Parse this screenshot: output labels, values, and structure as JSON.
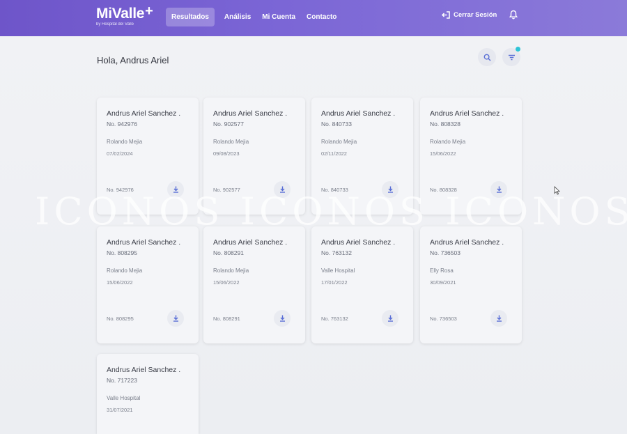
{
  "brand": {
    "name": "MiValle",
    "plus": "+",
    "subtitle": "by Hospital del Valle"
  },
  "nav": [
    {
      "label": "Resultados",
      "active": true
    },
    {
      "label": "Análisis",
      "active": false
    },
    {
      "label": "Mi Cuenta",
      "active": false
    },
    {
      "label": "Contacto",
      "active": false
    }
  ],
  "header": {
    "logout_label": "Cerrar Sesión",
    "logout_icon": "logout-icon",
    "notifications_icon": "bell-icon"
  },
  "page": {
    "greeting": "Hola, Andrus Ariel",
    "search_icon": "search-icon",
    "filter_icon": "filter-icon"
  },
  "results": [
    {
      "name": "Andrus Ariel Sanchez .",
      "number": "No. 942976",
      "doctor": "Rolando Mejia",
      "date": "07/02/2024",
      "footer": "No. 942976"
    },
    {
      "name": "Andrus Ariel Sanchez .",
      "number": "No. 902577",
      "doctor": "Rolando Mejia",
      "date": "09/08/2023",
      "footer": "No. 902577"
    },
    {
      "name": "Andrus Ariel Sanchez .",
      "number": "No. 840733",
      "doctor": "Rolando Mejia",
      "date": "02/11/2022",
      "footer": "No. 840733"
    },
    {
      "name": "Andrus Ariel Sanchez .",
      "number": "No. 808328",
      "doctor": "Rolando Mejia",
      "date": "15/06/2022",
      "footer": "No. 808328"
    },
    {
      "name": "Andrus Ariel Sanchez .",
      "number": "No. 808295",
      "doctor": "Rolando Mejia",
      "date": "15/06/2022",
      "footer": "No. 808295"
    },
    {
      "name": "Andrus Ariel Sanchez .",
      "number": "No. 808291",
      "doctor": "Rolando Mejia",
      "date": "15/06/2022",
      "footer": "No. 808291"
    },
    {
      "name": "Andrus Ariel Sanchez .",
      "number": "No. 763132",
      "doctor": "Valle Hospital",
      "date": "17/01/2022",
      "footer": "No. 763132"
    },
    {
      "name": "Andrus Ariel Sanchez .",
      "number": "No. 736503",
      "doctor": "Elly Rosa",
      "date": "30/09/2021",
      "footer": "No. 736503"
    },
    {
      "name": "Andrus Ariel Sanchez .",
      "number": "No. 717223",
      "doctor": "Valle Hospital",
      "date": "31/07/2021",
      "footer": ""
    }
  ],
  "watermark": "ICONOS ICONOS ICONOS",
  "colors": {
    "brand_purple": "#6e55c9",
    "accent_teal": "#2ec4d6",
    "download_blue": "#5a6fd6"
  }
}
